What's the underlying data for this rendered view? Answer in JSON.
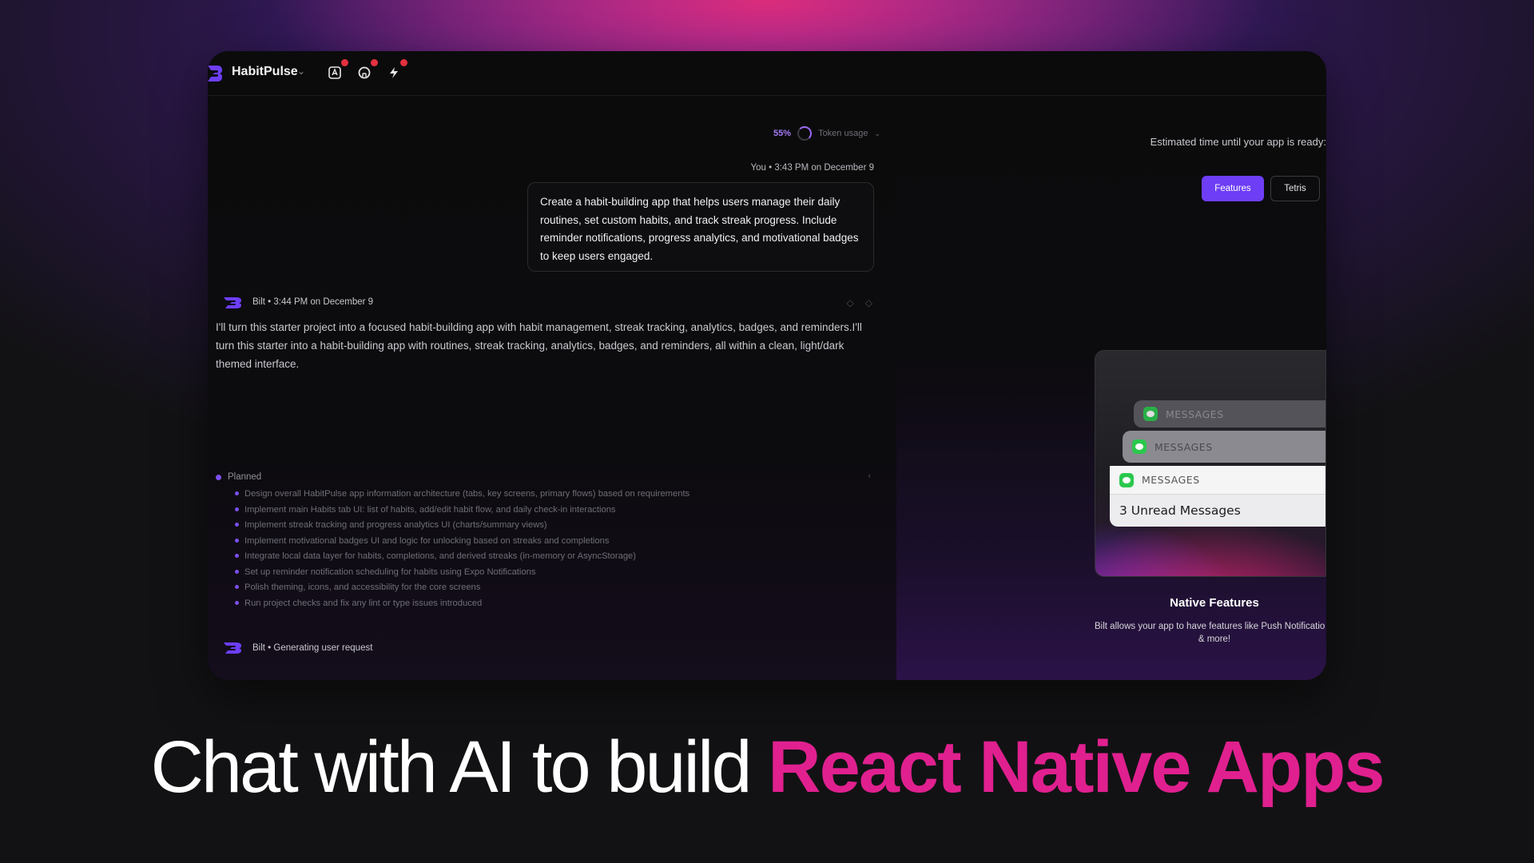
{
  "app": {
    "name": "HabitPulse"
  },
  "topbar": {
    "icons": [
      "appstore-icon",
      "github-icon",
      "bolt-icon"
    ]
  },
  "token": {
    "percent": "55%",
    "label": "Token usage"
  },
  "messages": {
    "user_meta": "You • 3:43 PM on December 9",
    "user_text": "Create a habit-building app that helps users manage their daily routines, set custom habits, and track streak progress. Include reminder notifications, progress analytics, and motivational badges to keep users engaged.",
    "bot_meta": "Bilt • 3:44 PM on December 9",
    "bot_text": "I'll turn this starter project into a focused habit-building app with habit management, streak tracking, analytics, badges, and reminders.I'll turn this starter into a habit-building app with routines, streak tracking, analytics, badges, and reminders, all within a clean, light/dark themed interface.",
    "generating": "Bilt • Generating user request"
  },
  "planned": {
    "label": "Planned",
    "items": [
      "Design overall HabitPulse app information architecture (tabs, key screens, primary flows) based on requirements",
      "Implement main Habits tab UI: list of habits, add/edit habit flow, and daily check-in interactions",
      "Implement streak tracking and progress analytics UI (charts/summary views)",
      "Implement motivational badges UI and logic for unlocking based on streaks and completions",
      "Integrate local data layer for habits, completions, and derived streaks (in-memory or AsyncStorage)",
      "Set up reminder notification scheduling for habits using Expo Notifications",
      "Polish theming, icons, and accessibility for the core screens",
      "Run project checks and fix any lint or type issues introduced"
    ]
  },
  "preview": {
    "estimate": "Estimated time until your app is ready:",
    "tab_features": "Features",
    "tab_tetris": "Tetris",
    "notif_label": "MESSAGES",
    "notif_body": "3 Unread Messages",
    "feature_title": "Native Features",
    "feature_desc": "Bilt allows your app to have features like Push Notificatio",
    "feature_desc2": "& more!"
  },
  "headline": {
    "plain": "Chat with AI to build ",
    "accent": "React Native Apps"
  },
  "colors": {
    "accent_purple": "#6d3ef5",
    "accent_pink": "#e0208f",
    "notif_green": "#2bc84d",
    "badge_red": "#e5303f"
  }
}
